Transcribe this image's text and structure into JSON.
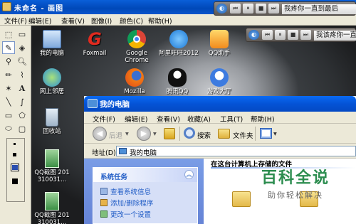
{
  "paint": {
    "title": "未命名 - 画图",
    "menu": [
      "文件(F)",
      "编辑(E)",
      "查看(V)",
      "图像(I)",
      "颜色(C)",
      "帮助(H)"
    ]
  },
  "desktop_icons": [
    {
      "label": "我的电脑",
      "icon": "my-computer-icon"
    },
    {
      "label": "Foxmail",
      "icon": "foxmail-icon"
    },
    {
      "label": "Google Chrome",
      "icon": "chrome-icon"
    },
    {
      "label": "阿里旺旺2012",
      "icon": "aliwangwang-icon"
    },
    {
      "label": "QQ助手",
      "icon": "qq-assistant-icon"
    },
    {
      "label": "网上邻居",
      "icon": "network-icon"
    },
    {
      "label": "Mozilla",
      "icon": "firefox-icon"
    },
    {
      "label": "腾讯QQ",
      "icon": "qq-icon"
    },
    {
      "label": "游戏大厅",
      "icon": "game-hall-icon"
    },
    {
      "label": "回收站",
      "icon": "recycle-bin-icon"
    },
    {
      "label": "QQ截图 201310031...",
      "icon": "screenshot-file-icon"
    },
    {
      "label": "QQ截图 201310031...",
      "icon": "screenshot-file-icon"
    }
  ],
  "player1": {
    "song": "我疼你一直到最后"
  },
  "player2": {
    "song": "我该疼你一直到最后"
  },
  "explorer": {
    "title": "我的电脑",
    "menu": [
      "文件(F)",
      "编辑(E)",
      "查看(V)",
      "收藏(A)",
      "工具(T)",
      "帮助(H)"
    ],
    "toolbar": {
      "back": "后退",
      "search": "搜索",
      "folders": "文件夹"
    },
    "address": {
      "label": "地址(D)",
      "value": "我的电脑"
    },
    "tasks": {
      "title": "系统任务",
      "items": [
        "查看系统信息",
        "添加/删除程序",
        "更改一个设置"
      ]
    },
    "content_header": "在这台计算机上存储的文件"
  },
  "watermark": {
    "brand": "百科全说",
    "slogan": "助你轻松解决"
  }
}
